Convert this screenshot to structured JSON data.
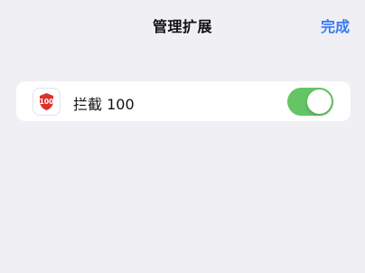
{
  "nav": {
    "title": "管理扩展",
    "done_label": "完成"
  },
  "extension": {
    "name": "拦截 100",
    "icon": "shield-100-icon",
    "icon_text": "100",
    "enabled": true
  },
  "colors": {
    "background": "#efeff4",
    "accent": "#3478f6",
    "toggle_on": "#65c466",
    "icon_red": "#d8342f"
  }
}
